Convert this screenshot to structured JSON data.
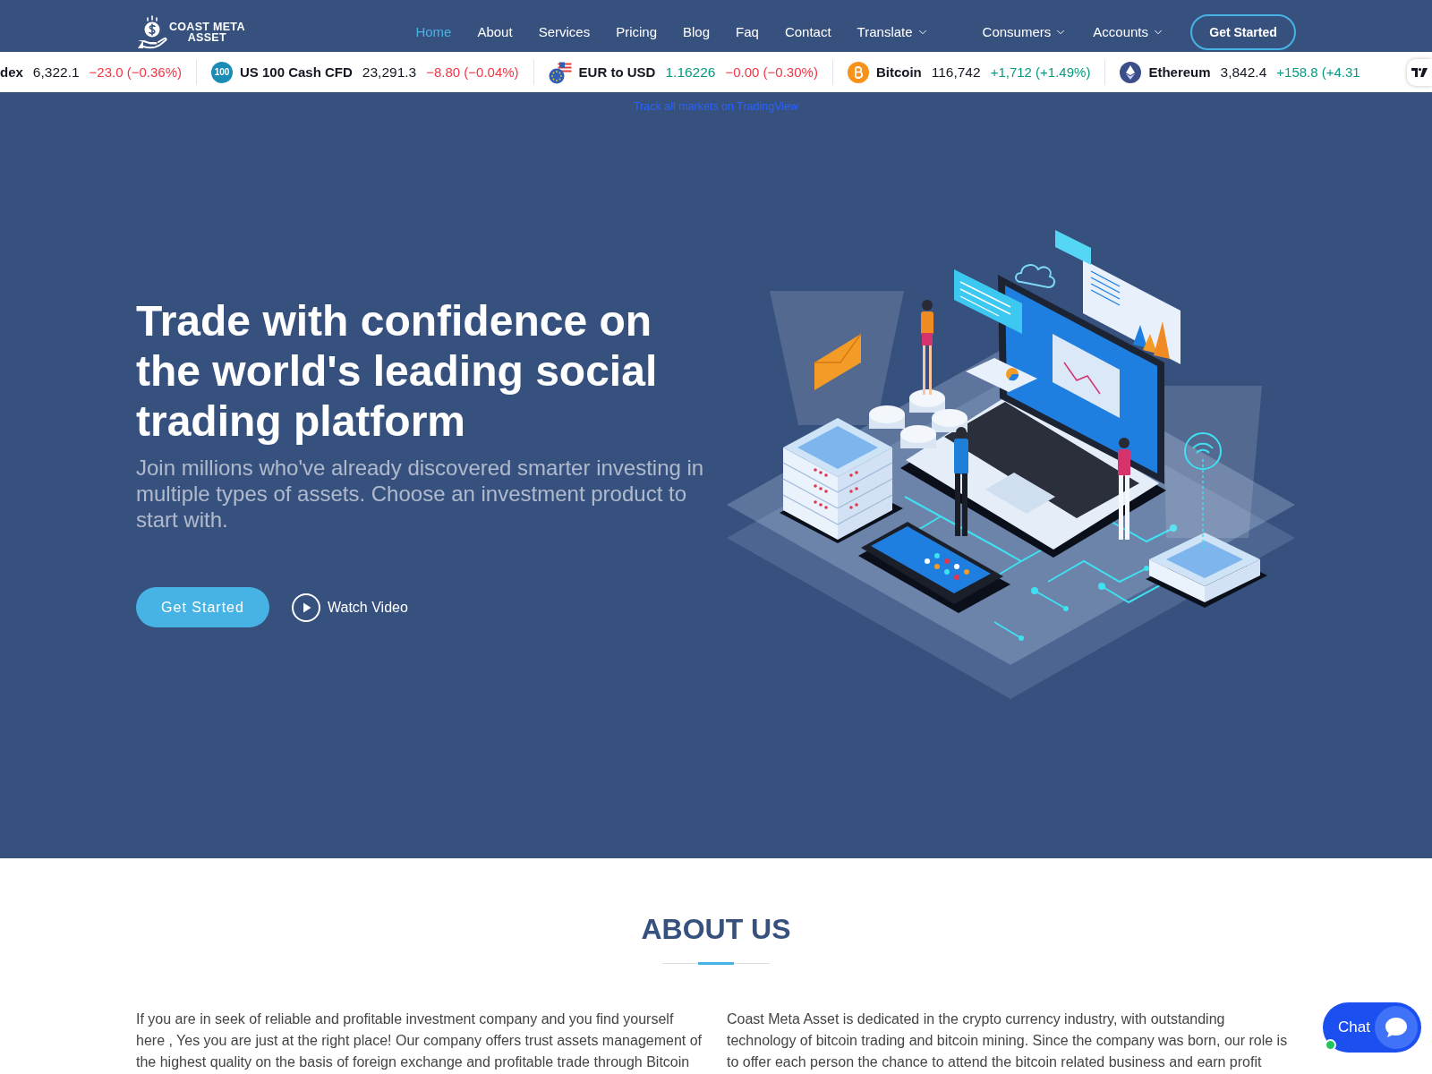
{
  "header": {
    "logo": {
      "lines": [
        "COAST META",
        "ASSET"
      ]
    },
    "nav": [
      {
        "label": "Home",
        "selected": true,
        "dropdown": false
      },
      {
        "label": "About",
        "selected": false,
        "dropdown": false
      },
      {
        "label": "Services",
        "selected": false,
        "dropdown": false
      },
      {
        "label": "Pricing",
        "selected": false,
        "dropdown": false
      },
      {
        "label": "Blog",
        "selected": false,
        "dropdown": false
      },
      {
        "label": "Faq",
        "selected": false,
        "dropdown": false
      },
      {
        "label": "Contact",
        "selected": false,
        "dropdown": false
      },
      {
        "label": "Translate",
        "selected": false,
        "dropdown": true
      }
    ],
    "account_menus": [
      {
        "label": "Consumers",
        "selected": false,
        "dropdown": true
      },
      {
        "label": "Accounts",
        "selected": false,
        "dropdown": true
      }
    ],
    "cta": "Get Started"
  },
  "ticker": {
    "items": [
      {
        "kind": "plain",
        "name": "dex",
        "price": "6,322.1",
        "price_rising": false,
        "change": "−23.0 (−0.36%)",
        "change_rising": false
      },
      {
        "kind": "index",
        "badge": "100",
        "name": "US 100 Cash CFD",
        "price": "23,291.3",
        "price_rising": false,
        "change": "−8.80 (−0.04%)",
        "change_rising": false
      },
      {
        "kind": "pair",
        "name": "EUR to USD",
        "price": "1.16226",
        "price_rising": true,
        "change": "−0.00 (−0.30%)",
        "change_rising": false
      },
      {
        "kind": "bitcoin",
        "name": "Bitcoin",
        "price": "116,742",
        "price_rising": false,
        "change": "+1,712 (+1.49%)",
        "change_rising": true
      },
      {
        "kind": "ethereum",
        "name": "Ethereum",
        "price": "3,842.4",
        "price_rising": false,
        "change": "+158.8 (+4.31",
        "change_rising": true
      }
    ],
    "link": "Track all markets on TradingView"
  },
  "hero": {
    "title": "Trade with confidence on the world's leading social trading platform",
    "subtitle": "Join millions who've already discovered smarter investing in multiple types of assets. Choose an investment product to start with.",
    "primary_button": "Get Started",
    "video_link": "Watch Video"
  },
  "about": {
    "title": "ABOUT US",
    "paragraphs": [
      "If you are in seek of reliable and profitable investment company and you find yourself here , Yes you are just at the right place! Our company offers trust assets management of the highest quality on the basis of foreign exchange and profitable trade through Bitcoin",
      "Coast Meta Asset is dedicated in the crypto currency industry, with outstanding technology of bitcoin trading and bitcoin mining. Since the company was born, our role is to offer each person the chance to attend the bitcoin related business and earn profit"
    ]
  },
  "chat": {
    "label": "Chat",
    "online": true
  }
}
